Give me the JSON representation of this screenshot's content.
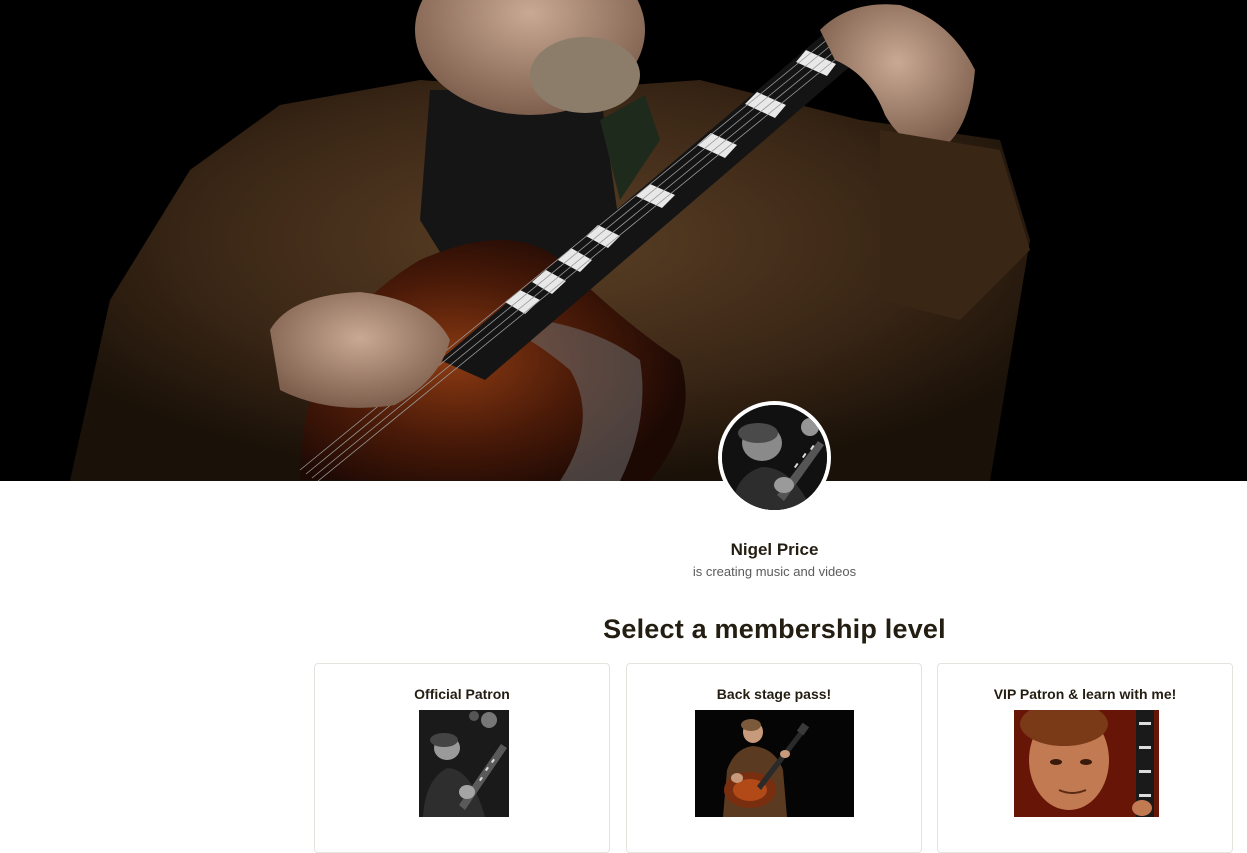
{
  "creator": {
    "name": "Nigel Price",
    "tagline": "is creating music and videos"
  },
  "membership": {
    "heading": "Select a membership level",
    "tiers": [
      {
        "title": "Official Patron"
      },
      {
        "title": "Back stage pass!"
      },
      {
        "title": "VIP Patron & learn with me!"
      }
    ]
  },
  "colors": {
    "text": "#241e12",
    "muted": "#5b5b5b",
    "card_border": "#e5e3dd"
  },
  "icons": {
    "hero": "cover-photo-guitarist",
    "avatar": "profile-photo"
  }
}
